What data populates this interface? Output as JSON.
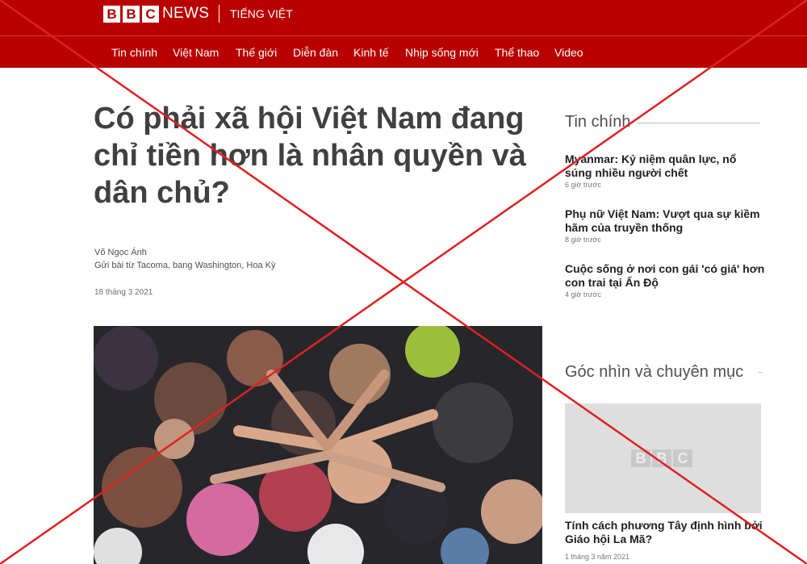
{
  "brand": {
    "logo_letters": [
      "B",
      "B",
      "C"
    ],
    "news": "NEWS",
    "language": "TIẾNG VIỆT"
  },
  "nav": {
    "items": [
      "Tin chính",
      "Việt Nam",
      "Thế giới",
      "Diễn đàn",
      "Kinh tế",
      "Nhịp sống mới",
      "Thể thao",
      "Video"
    ]
  },
  "article": {
    "headline_lines": [
      "Có phải xã hội Việt Nam đang",
      "chỉ tiền hơn là nhân quyền và",
      "dân chủ?"
    ],
    "author": "Võ Ngọc Ánh",
    "author_location": "Gửi bài từ Tacoma, bang Washington, Hoa Kỳ",
    "date": "18 tháng 3 2021"
  },
  "sidebar": {
    "top_heading": "Tin chính",
    "stories": [
      {
        "title": "Myanmar: Kỷ niệm quân lực, nổ súng nhiều người chết",
        "time": "6 giờ trước"
      },
      {
        "title": "Phụ nữ Việt Nam: Vượt qua sự kiềm hãm của truyền thống",
        "time": "8 giờ trước"
      },
      {
        "title": "Cuộc sống ở nơi con gái 'có giá' hơn con trai tại Ấn Độ",
        "time": "4 giờ trước"
      }
    ],
    "features_heading": "Góc nhìn và chuyên mục",
    "feature": {
      "thumb_letters": [
        "B",
        "B",
        "C"
      ],
      "title": "Tính cách phương Tây định hình bởi Giáo hội La Mã?",
      "time": "1 tháng 3 năm 2021"
    }
  },
  "colors": {
    "brand_red": "#b80000",
    "overlay_x": "#e02020"
  },
  "icons": {
    "overlay": "red-cross-out-mark"
  }
}
